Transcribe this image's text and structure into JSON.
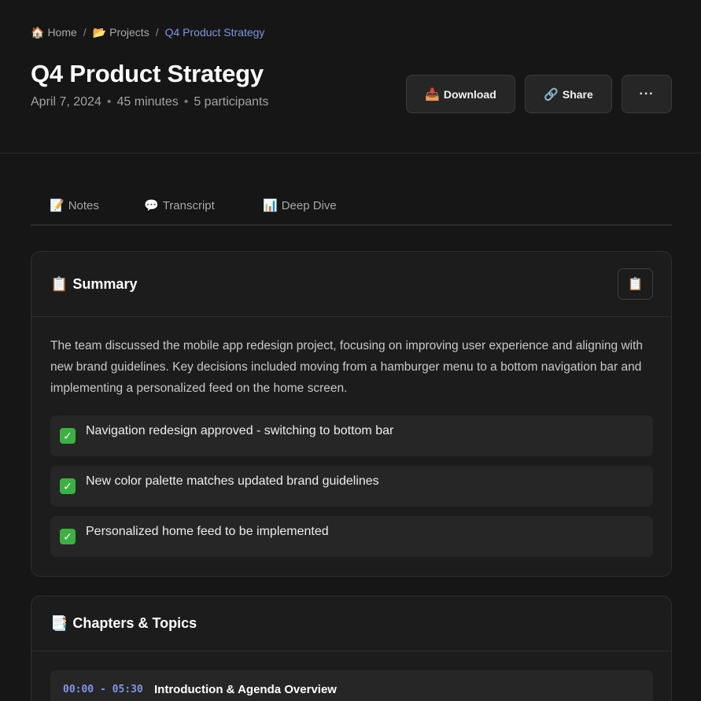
{
  "breadcrumb": {
    "items": [
      {
        "icon": "🏠",
        "label": "Home"
      },
      {
        "icon": "📂",
        "label": "Projects"
      }
    ],
    "separator": "/",
    "current": "Q4 Product Strategy"
  },
  "header": {
    "title": "Q4 Product Strategy",
    "date": "April 7, 2024",
    "duration": "45 minutes",
    "participants": "5 participants",
    "meta_separator": "•"
  },
  "actions": {
    "download": {
      "icon": "📥",
      "label": "Download"
    },
    "share": {
      "icon": "🔗",
      "label": "Share"
    },
    "more": {
      "label": "···"
    }
  },
  "tabs": [
    {
      "icon": "📝",
      "label": "Notes"
    },
    {
      "icon": "💬",
      "label": "Transcript"
    },
    {
      "icon": "📊",
      "label": "Deep Dive"
    }
  ],
  "summary": {
    "icon": "📋",
    "title": "Summary",
    "copy_icon": "📋",
    "text": "The team discussed the mobile app redesign project, focusing on improving user experience and aligning with new brand guidelines. Key decisions included moving from a hamburger menu to a bottom navigation bar and implementing a personalized feed on the home screen.",
    "decisions": [
      {
        "check": "✓",
        "text": "Navigation redesign approved - switching to bottom bar"
      },
      {
        "check": "✓",
        "text": "New color palette matches updated brand guidelines"
      },
      {
        "check": "✓",
        "text": "Personalized home feed to be implemented"
      }
    ]
  },
  "chapters": {
    "icon": "📑",
    "title": "Chapters & Topics",
    "items": [
      {
        "time": "00:00 - 05:30",
        "title": "Introduction & Agenda Overview"
      }
    ]
  },
  "colors": {
    "background": "#161616",
    "card": "#1c1c1c",
    "accent": "#7f95e6",
    "check": "#3cb043"
  }
}
